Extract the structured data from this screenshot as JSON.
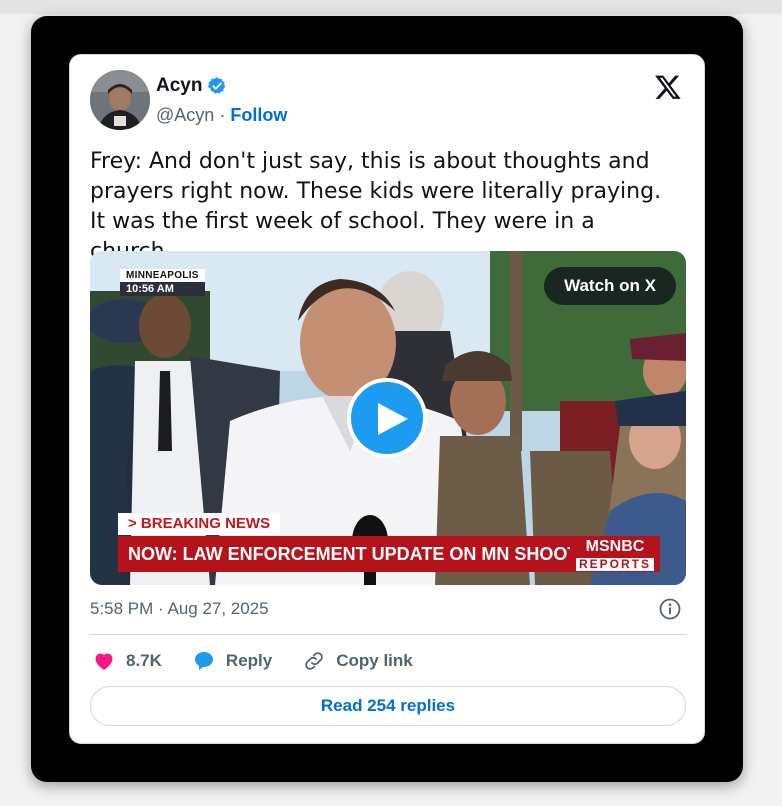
{
  "author": {
    "name": "Acyn",
    "handle": "@Acyn",
    "separator": "·",
    "follow_label": "Follow",
    "verified": true
  },
  "brand": {
    "logo": "x-logo-icon"
  },
  "tweet": {
    "text": "Frey: And don't just say, this is about thoughts and prayers right now. These kids were literally praying. It was the first week of school. They were in a church."
  },
  "media": {
    "watch_label": "Watch on X",
    "location": "MINNEAPOLIS",
    "location_time": "10:56 AM",
    "breaking_label": "> BREAKING NEWS",
    "headline": "NOW: LAW ENFORCEMENT UPDATE ON MN SHOOTING",
    "network_name": "MSNBC",
    "network_sub": "REPORTS"
  },
  "meta": {
    "timestamp": "5:58 PM · Aug 27, 2025"
  },
  "actions": {
    "likes_count": "8.7K",
    "reply_label": "Reply",
    "copy_link_label": "Copy link"
  },
  "read_replies_label": "Read 254 replies",
  "colors": {
    "link_blue": "#006fd6",
    "verified_blue": "#1d9bf0",
    "like_pink": "#f91880",
    "breaking_red": "#b5121b"
  }
}
